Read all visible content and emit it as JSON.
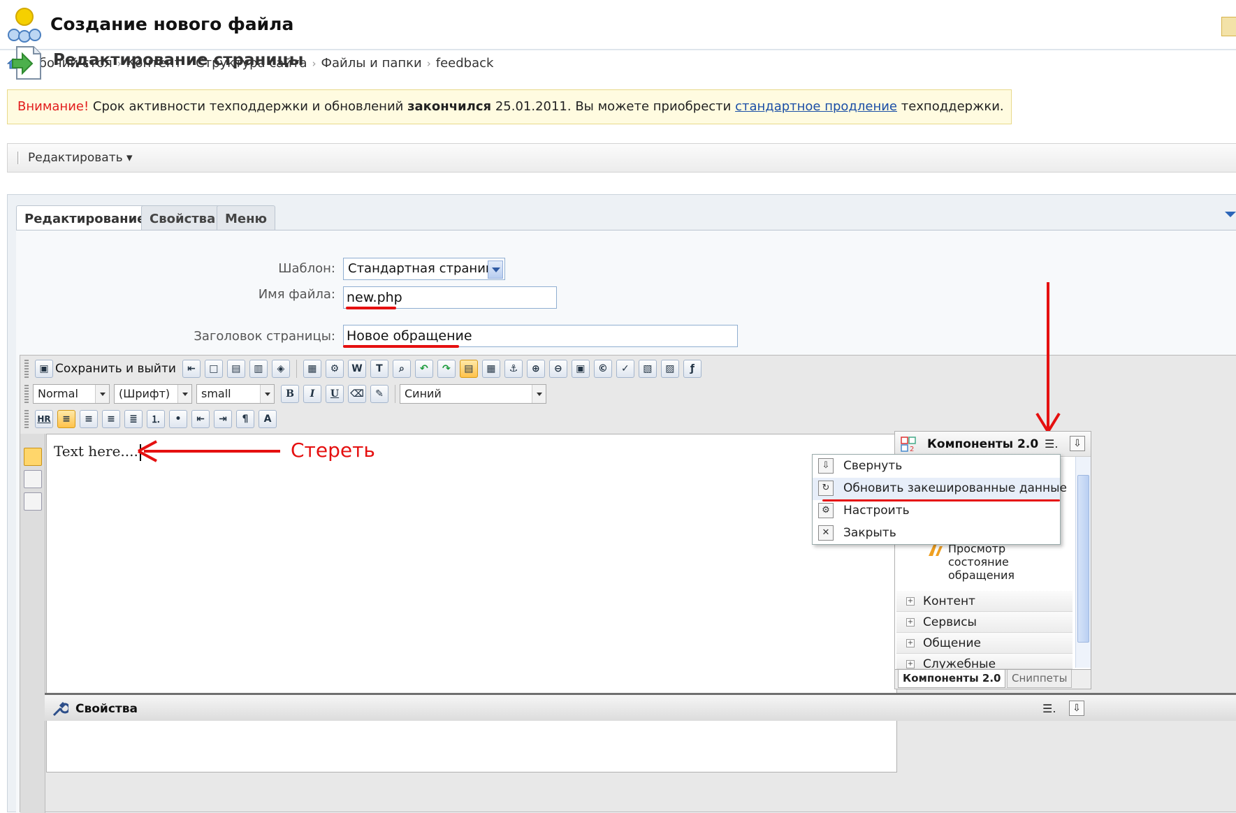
{
  "header": {
    "title": "Создание нового файла"
  },
  "breadcrumb": [
    "Рабочий стол",
    "Контент",
    "Структура сайта",
    "Файлы и папки",
    "feedback"
  ],
  "warning": {
    "prefix": "Внимание!",
    "text_1": " Срок активности техподдержки и обновлений ",
    "bold": "закончился",
    "text_2": " 25.01.2011. Вы можете приобрести ",
    "link": "стандартное продление",
    "text_3": " техподдержки."
  },
  "action_bar": {
    "edit_menu": "Редактировать ▾"
  },
  "tabs": [
    {
      "label": "Редактирование",
      "active": true
    },
    {
      "label": "Свойства",
      "active": false
    },
    {
      "label": "Меню",
      "active": false
    }
  ],
  "section": {
    "title": "Редактирование страницы"
  },
  "form": {
    "template_label": "Шаблон:",
    "template_value": "Стандартная страница",
    "filename_label": "Имя файла:",
    "filename_value": "new.php",
    "pagetitle_label": "Заголовок страницы:",
    "pagetitle_value": "Новое обращение"
  },
  "toolbar": {
    "save_exit": "Сохранить и выйти",
    "format_value": "Normal",
    "font_value": "(Шрифт)",
    "size_value": "small",
    "color_value": "Синий",
    "bold": "B",
    "italic": "I",
    "underline": "U",
    "hr": "HR"
  },
  "editor": {
    "content": "Text here...."
  },
  "annotation": {
    "erase_label": "Стереть",
    "color": "#e51010"
  },
  "components": {
    "title": "Компоненты 2.0",
    "item": "Просмотр состояние обращения",
    "categories": [
      "Контент",
      "Сервисы",
      "Общение",
      "Служебные"
    ],
    "tabs": [
      "Компоненты 2.0",
      "Сниппеты"
    ]
  },
  "context_menu": [
    {
      "label": "Свернуть",
      "icon": "collapse-icon"
    },
    {
      "label": "Обновить закешированные данные",
      "icon": "refresh-icon"
    },
    {
      "label": "Настроить",
      "icon": "gear-icon"
    },
    {
      "label": "Закрыть",
      "icon": "close-icon"
    }
  ],
  "properties_bar": {
    "title": "Свойства"
  }
}
